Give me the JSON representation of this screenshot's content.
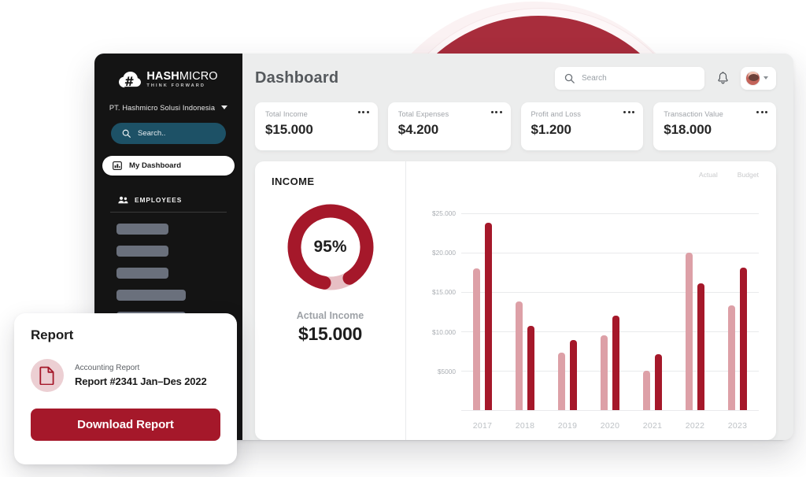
{
  "theme": {
    "brand_red": "#a5182a",
    "brand_red_light": "#dda0a7",
    "sidebar_bg": "#141414",
    "search_teal": "#1d5166",
    "app_bg": "#eceded"
  },
  "sidebar": {
    "logo": {
      "icon": "cloud-hash-icon",
      "name_bold": "HASH",
      "name_light": "MICRO",
      "tagline": "THINK FORWARD"
    },
    "company": {
      "name": "PT. Hashmicro Solusi Indonesia",
      "caret_icon": "chevron-down-icon"
    },
    "search": {
      "icon": "search-icon",
      "placeholder": "Search.."
    },
    "active_item": {
      "icon": "dashboard-icon",
      "label": "My Dashboard"
    },
    "section": {
      "icon": "employees-icon",
      "label": "EMPLOYEES"
    },
    "skeleton_widths": [
      66,
      66,
      66,
      88,
      88
    ]
  },
  "header": {
    "title": "Dashboard",
    "search": {
      "icon": "search-icon",
      "placeholder": "Search"
    },
    "bell_icon": "bell-icon",
    "avatar_icon": "avatar",
    "avatar_caret_icon": "chevron-down-icon"
  },
  "kpis": [
    {
      "label": "Total Income",
      "value": "$15.000",
      "menu_icon": "more-horizontal-icon"
    },
    {
      "label": "Total Expenses",
      "value": "$4.200",
      "menu_icon": "more-horizontal-icon"
    },
    {
      "label": "Profit and Loss",
      "value": "$1.200",
      "menu_icon": "more-horizontal-icon"
    },
    {
      "label": "Transaction Value",
      "value": "$18.000",
      "menu_icon": "more-horizontal-icon"
    }
  ],
  "income_panel": {
    "title": "INCOME",
    "donut": {
      "percent_label": "95%",
      "percent_value": 95,
      "track_color": "#e7bfc4",
      "fill_color": "#a5182a"
    },
    "actual_label": "Actual Income",
    "actual_value": "$15.000"
  },
  "report_card": {
    "title": "Report",
    "file_icon": "document-icon",
    "subtitle": "Accounting Report",
    "name": "Report #2341 Jan–Des 2022",
    "button_label": "Download Report"
  },
  "chart_data": {
    "type": "bar",
    "title": "",
    "xlabel": "",
    "ylabel": "",
    "categories": [
      "2017",
      "2018",
      "2019",
      "2020",
      "2021",
      "2022",
      "2023"
    ],
    "series": [
      {
        "name": "Actual",
        "color": "#dda0a7",
        "values": [
          18000,
          13800,
          7300,
          9500,
          5000,
          20000,
          13300
        ]
      },
      {
        "name": "Budget",
        "color": "#a5182a",
        "values": [
          23800,
          10700,
          8900,
          12000,
          7100,
          16100,
          18100
        ]
      }
    ],
    "ylim": [
      0,
      27000
    ],
    "yticks": [
      5000,
      10000,
      15000,
      20000,
      25000
    ],
    "ytick_labels": [
      "$5000",
      "$10.000",
      "$15.000",
      "$20.000",
      "$25.000"
    ],
    "grid": true,
    "legend_position": "top-right"
  }
}
